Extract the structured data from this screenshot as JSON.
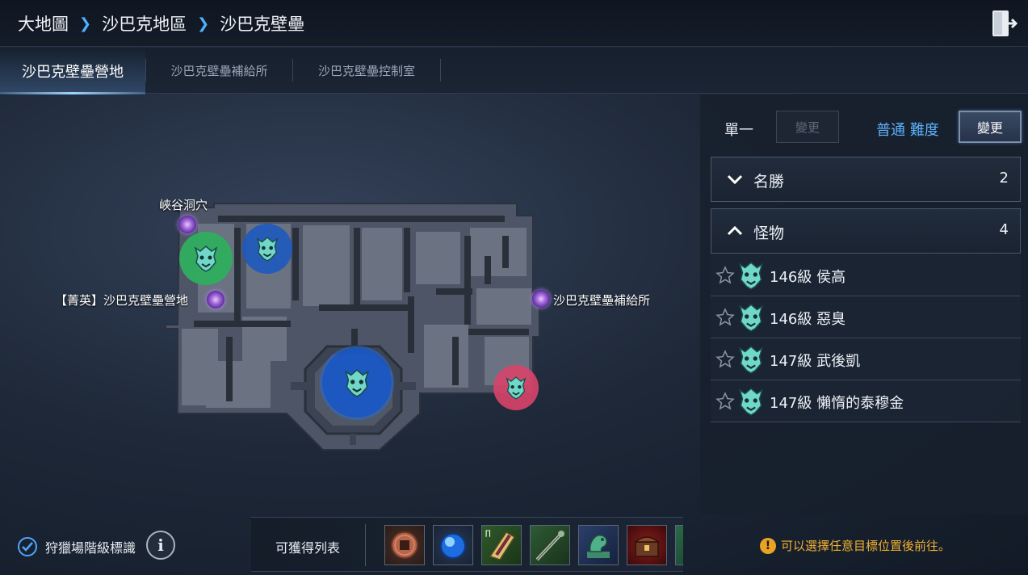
{
  "breadcrumb": [
    "大地圖",
    "沙巴克地區",
    "沙巴克壁壘"
  ],
  "tabs": [
    {
      "label": "沙巴克壁壘營地",
      "active": true
    },
    {
      "label": "沙巴克壁壘補給所",
      "active": false
    },
    {
      "label": "沙巴克壁壘控制室",
      "active": false
    }
  ],
  "map": {
    "labels": {
      "canyon_cave": "峽谷洞穴",
      "elite_camp": "【菁英】沙巴克壁壘營地",
      "supply": "沙巴克壁壘補給所"
    },
    "marker_colors": {
      "green": "#2fae5e",
      "blue": "#1f5fc4",
      "red": "#d8446a"
    }
  },
  "panel": {
    "mode_label": "單一",
    "mode_change": "變更",
    "difficulty": "普通 難度",
    "difficulty_change": "變更",
    "sections": [
      {
        "label": "名勝",
        "count": "2",
        "expanded": false
      },
      {
        "label": "怪物",
        "count": "4",
        "expanded": true
      }
    ],
    "monsters": [
      {
        "label": "146級 侯高"
      },
      {
        "label": "146級 惡臭"
      },
      {
        "label": "147級 武後凱"
      },
      {
        "label": "147級 懶惰的泰穆金"
      }
    ]
  },
  "bottom": {
    "hunt_toggle_label": "狩獵場階級標識",
    "hunt_toggle_checked": true,
    "info_icon": "i",
    "drops_label": "可獲得列表",
    "drops": [
      {
        "icon": "coin-icon"
      },
      {
        "icon": "blue-orb-icon"
      },
      {
        "icon": "armor-icon"
      },
      {
        "icon": "staff-icon"
      },
      {
        "icon": "jade-dragon-icon"
      },
      {
        "icon": "treasure-chest-icon"
      }
    ],
    "hint": "可以選擇任意目標位置後前往。",
    "hint_icon": "!"
  }
}
